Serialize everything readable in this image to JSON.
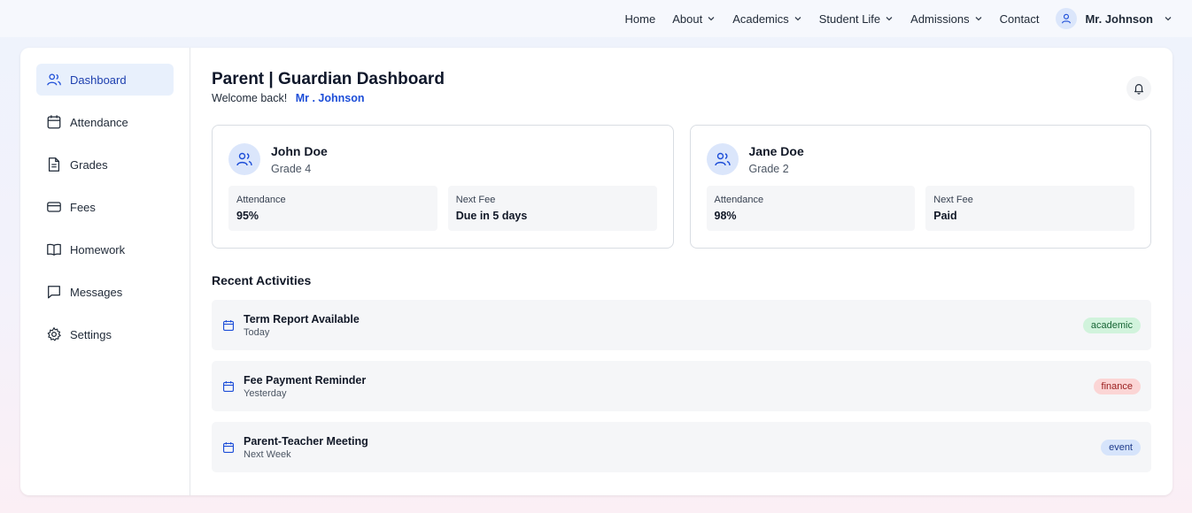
{
  "nav": {
    "items": [
      {
        "label": "Home",
        "dropdown": false
      },
      {
        "label": "About",
        "dropdown": true
      },
      {
        "label": "Academics",
        "dropdown": true
      },
      {
        "label": "Student Life",
        "dropdown": true
      },
      {
        "label": "Admissions",
        "dropdown": true
      },
      {
        "label": "Contact",
        "dropdown": false
      }
    ],
    "user": {
      "name": "Mr. Johnson",
      "icon": "user-icon"
    }
  },
  "sidebar": {
    "items": [
      {
        "label": "Dashboard",
        "icon": "users-icon",
        "active": true
      },
      {
        "label": "Attendance",
        "icon": "calendar-icon",
        "active": false
      },
      {
        "label": "Grades",
        "icon": "document-icon",
        "active": false
      },
      {
        "label": "Fees",
        "icon": "credit-card-icon",
        "active": false
      },
      {
        "label": "Homework",
        "icon": "book-icon",
        "active": false
      },
      {
        "label": "Messages",
        "icon": "message-icon",
        "active": false
      },
      {
        "label": "Settings",
        "icon": "gear-icon",
        "active": false
      }
    ]
  },
  "header": {
    "title": "Parent | Guardian Dashboard",
    "welcome": "Welcome back!",
    "name": "Mr . Johnson",
    "bell_icon": "bell-icon"
  },
  "children": [
    {
      "name": "John Doe",
      "grade": "Grade 4",
      "attendance_label": "Attendance",
      "attendance": "95%",
      "fee_label": "Next Fee",
      "fee": "Due in 5 days"
    },
    {
      "name": "Jane Doe",
      "grade": "Grade 2",
      "attendance_label": "Attendance",
      "attendance": "98%",
      "fee_label": "Next Fee",
      "fee": "Paid"
    }
  ],
  "activities": {
    "title": "Recent Activities",
    "items": [
      {
        "title": "Term Report Available",
        "date": "Today",
        "tag": "academic",
        "tag_bg": "#d1f3dc",
        "tag_fg": "#166534"
      },
      {
        "title": "Fee Payment Reminder",
        "date": "Yesterday",
        "tag": "finance",
        "tag_bg": "#fbd5d5",
        "tag_fg": "#991b1b"
      },
      {
        "title": "Parent-Teacher Meeting",
        "date": "Next Week",
        "tag": "event",
        "tag_bg": "#d6e4fb",
        "tag_fg": "#1e3a8a"
      }
    ]
  },
  "colors": {
    "accent": "#1d4ed8",
    "active_bg": "#e8f0fc"
  }
}
